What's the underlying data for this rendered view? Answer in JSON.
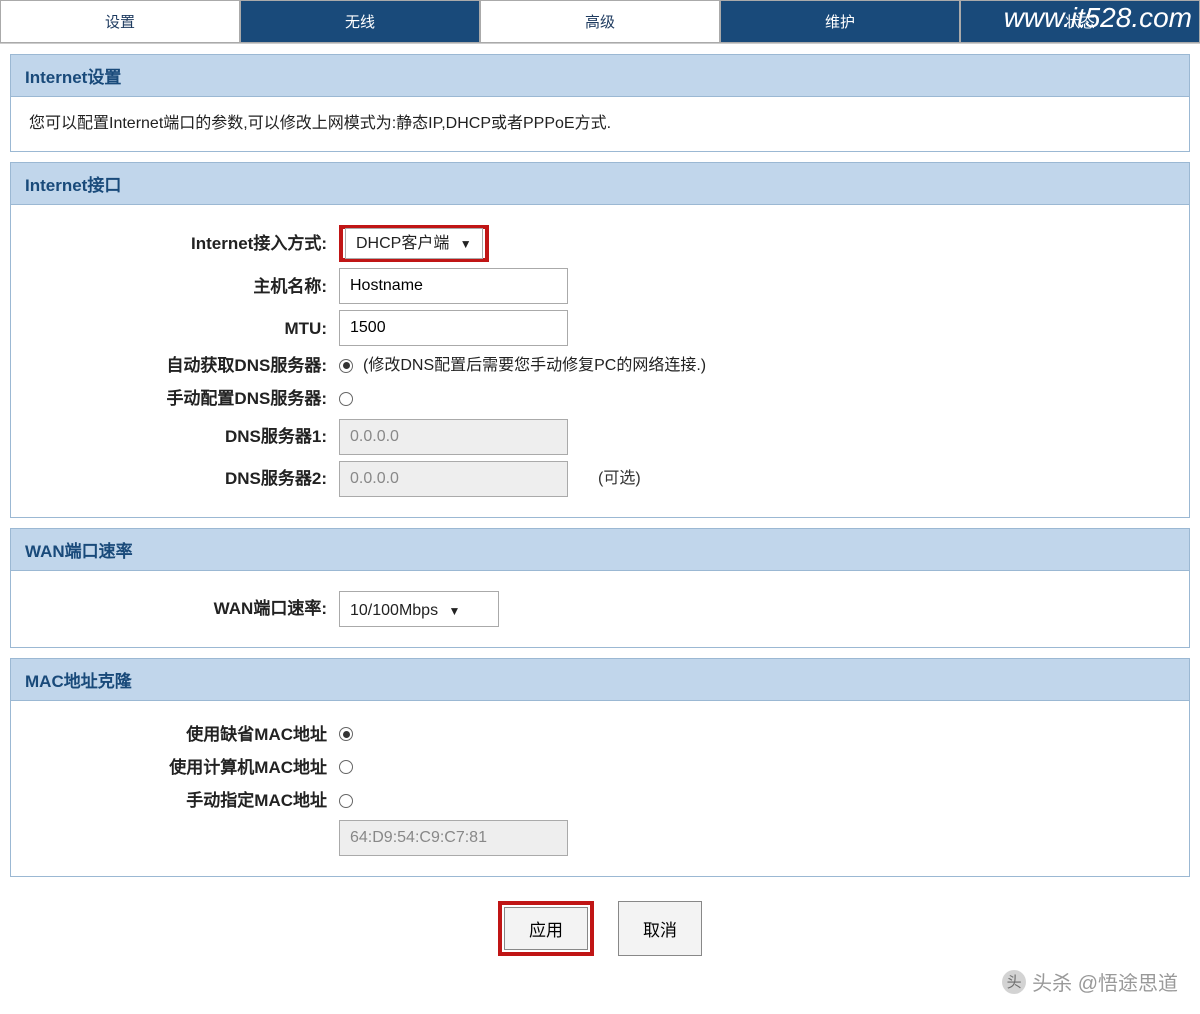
{
  "tabs": {
    "t0": "设置",
    "t1": "无线",
    "t2": "高级",
    "t3": "维护",
    "t4": "状态"
  },
  "overlay": {
    "url": "www.it528.com"
  },
  "section_settings": {
    "title": "Internet设置",
    "desc": "您可以配置Internet端口的参数,可以修改上网模式为:静态IP,DHCP或者PPPoE方式."
  },
  "section_interface": {
    "title": "Internet接口",
    "access_mode_label": "Internet接入方式:",
    "access_mode_value": "DHCP客户端",
    "hostname_label": "主机名称:",
    "hostname_value": "Hostname",
    "mtu_label": "MTU:",
    "mtu_value": "1500",
    "auto_dns_label": "自动获取DNS服务器:",
    "auto_dns_hint": "(修改DNS配置后需要您手动修复PC的网络连接.)",
    "manual_dns_label": "手动配置DNS服务器:",
    "dns1_label": "DNS服务器1:",
    "dns1_value": "0.0.0.0",
    "dns2_label": "DNS服务器2:",
    "dns2_value": "0.0.0.0",
    "dns2_optional": "(可选)"
  },
  "section_wan": {
    "title": "WAN端口速率",
    "label": "WAN端口速率:",
    "value": "10/100Mbps"
  },
  "section_mac": {
    "title": "MAC地址克隆",
    "opt_default": "使用缺省MAC地址",
    "opt_pc": "使用计算机MAC地址",
    "opt_manual": "手动指定MAC地址",
    "mac_value": "64:D9:54:C9:C7:81"
  },
  "buttons": {
    "apply": "应用",
    "cancel": "取消"
  },
  "watermark": {
    "text": "头杀 @悟途思道"
  }
}
